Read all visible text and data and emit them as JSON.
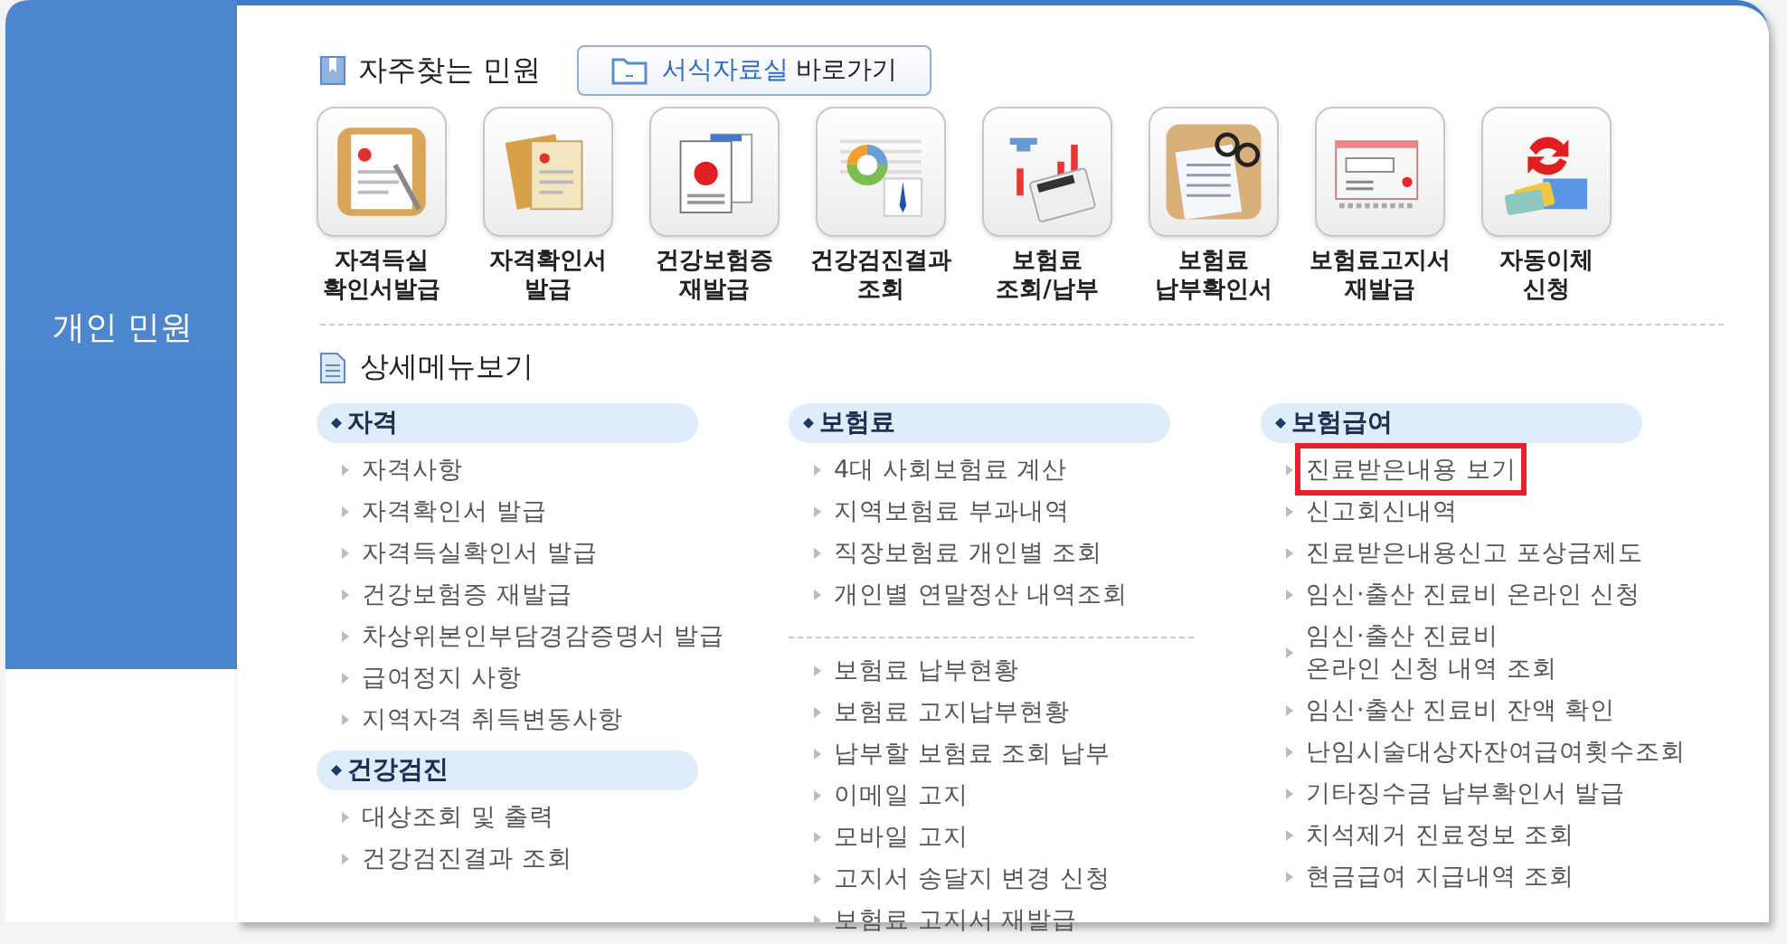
{
  "sidebar": {
    "title": "개인 민원"
  },
  "frequent": {
    "title": "자주찾는 민원",
    "link": {
      "highlight": "서식자료실",
      "label": "바로가기"
    },
    "items": [
      {
        "label": "자격득실\n확인서발급"
      },
      {
        "label": "자격확인서\n발급"
      },
      {
        "label": "건강보험증\n재발급"
      },
      {
        "label": "건강검진결과\n조회"
      },
      {
        "label": "보험료\n조회/납부"
      },
      {
        "label": "보험료\n납부확인서"
      },
      {
        "label": "보험료고지서\n재발급"
      },
      {
        "label": "자동이체\n신청"
      }
    ]
  },
  "detail": {
    "title": "상세메뉴보기",
    "columns": [
      [
        {
          "title": "자격",
          "items": [
            {
              "label": "자격사항",
              "selected": false
            },
            {
              "label": "자격확인서 발급",
              "selected": false
            },
            {
              "label": "자격득실확인서 발급",
              "selected": false
            },
            {
              "label": "건강보험증 재발급",
              "selected": false
            },
            {
              "label": "차상위본인부담경감증명서 발급",
              "selected": false
            },
            {
              "label": "급여정지 사항",
              "selected": false
            },
            {
              "label": "지역자격 취득변동사항",
              "selected": false
            }
          ]
        },
        {
          "title": "건강검진",
          "items": [
            {
              "label": "대상조회 및 출력",
              "selected": false
            },
            {
              "label": "건강검진결과 조회",
              "selected": false
            }
          ]
        }
      ],
      [
        {
          "title": "보험료",
          "items": [
            {
              "label": "4대 사회보험료 계산",
              "selected": false
            },
            {
              "label": "지역보험료 부과내역",
              "selected": false
            },
            {
              "label": "직장보험료 개인별 조회",
              "selected": false
            },
            {
              "label": "개인별 연말정산 내역조회",
              "selected": false
            }
          ]
        },
        {
          "items": [
            {
              "label": "보험료 납부현황",
              "selected": false
            },
            {
              "label": "보험료 고지납부현황",
              "selected": false
            },
            {
              "label": "납부할 보험료 조회 납부",
              "selected": false
            },
            {
              "label": "이메일 고지",
              "selected": false
            },
            {
              "label": "모바일 고지",
              "selected": false
            },
            {
              "label": "고지서 송달지 변경 신청",
              "selected": false
            },
            {
              "label": "보험료 고지서 재발급",
              "selected": false
            }
          ]
        }
      ],
      [
        {
          "title": "보험급여",
          "items": [
            {
              "label": "진료받은내용 보기",
              "selected": true
            },
            {
              "label": "신고회신내역",
              "selected": false
            },
            {
              "label": "진료받은내용신고 포상금제도",
              "selected": false
            },
            {
              "label": "임신·출산 진료비 온라인 신청",
              "selected": false
            },
            {
              "label": "임신·출산 진료비\n온라인 신청 내역 조회",
              "selected": false
            },
            {
              "label": "임신·출산 진료비 잔액 확인",
              "selected": false
            },
            {
              "label": "난임시술대상자잔여급여횟수조회",
              "selected": false
            },
            {
              "label": "기타징수금 납부확인서 발급",
              "selected": false
            },
            {
              "label": "치석제거 진료정보 조회",
              "selected": false
            },
            {
              "label": "현금급여 지급내역 조회",
              "selected": false
            }
          ]
        }
      ]
    ]
  }
}
